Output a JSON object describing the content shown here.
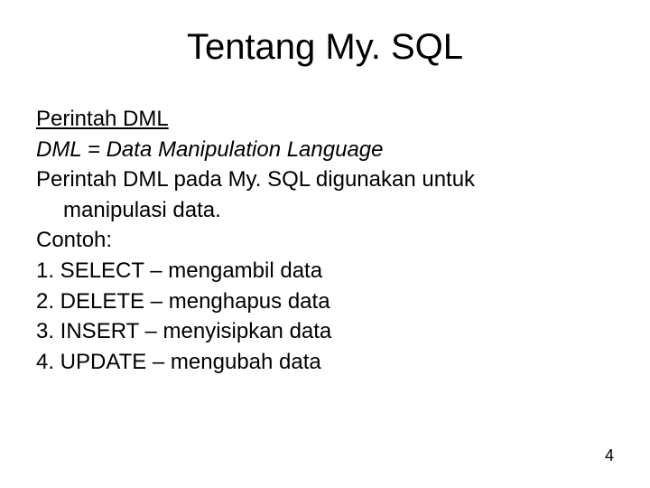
{
  "slide": {
    "title": "Tentang My. SQL",
    "subtitle": "Perintah DML",
    "definition": "DML = Data Manipulation Language",
    "description_line1": "Perintah DML pada My. SQL digunakan untuk",
    "description_line2": "manipulasi data.",
    "example_label": "Contoh:",
    "items": [
      "1. SELECT – mengambil data",
      "2. DELETE – menghapus data",
      "3. INSERT – menyisipkan data",
      "4. UPDATE – mengubah data"
    ],
    "page_number": "4"
  }
}
